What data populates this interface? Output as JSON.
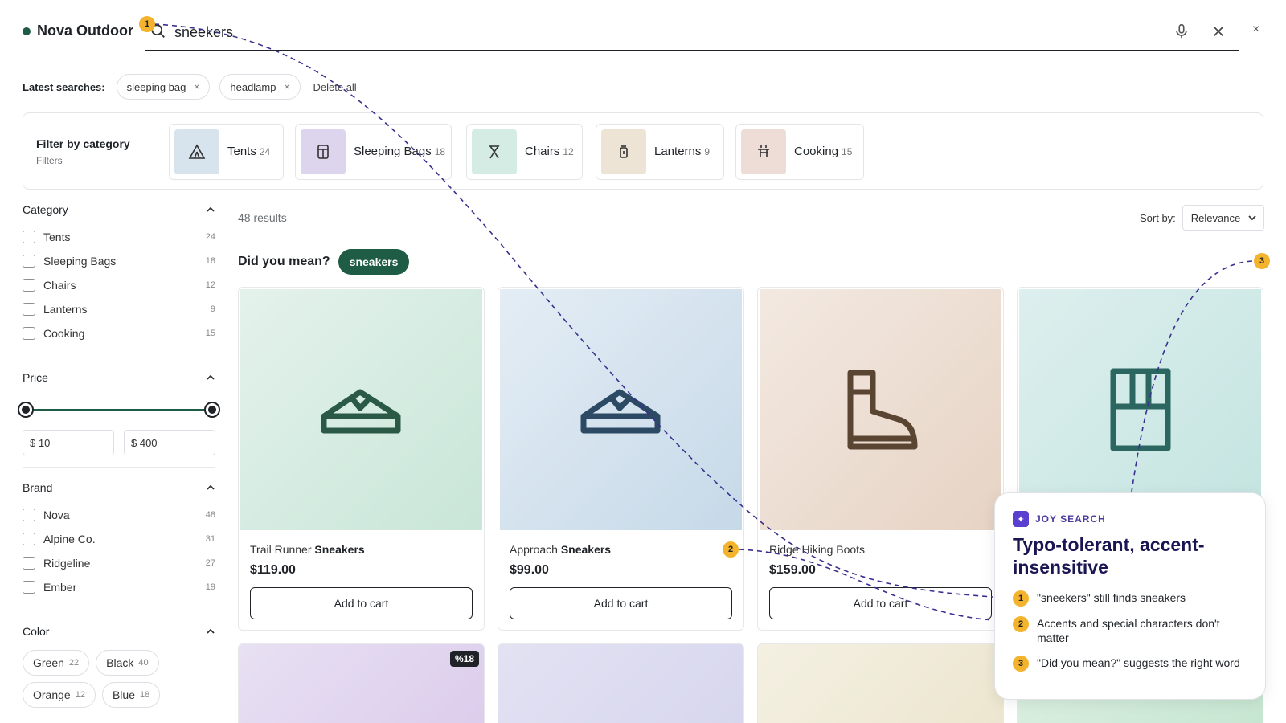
{
  "header": {
    "brand": "Nova Outdoor",
    "search_value": "sneekers",
    "close_label": "×"
  },
  "latest": {
    "label": "Latest searches:",
    "items": [
      "sleeping bag",
      "headlamp"
    ],
    "delete_all": "Delete all"
  },
  "category_bar": {
    "title": "Filter by category",
    "subtitle": "Filters",
    "items": [
      {
        "name": "Tents",
        "count": "24",
        "icon": "tent-icon",
        "bg": "#d7e4ee"
      },
      {
        "name": "Sleeping Bags",
        "count": "18",
        "icon": "sleeping-bag-icon",
        "bg": "#ddd5ee"
      },
      {
        "name": "Chairs",
        "count": "12",
        "icon": "chair-icon",
        "bg": "#d4ece3"
      },
      {
        "name": "Lanterns",
        "count": "9",
        "icon": "lantern-icon",
        "bg": "#ede4d6"
      },
      {
        "name": "Cooking",
        "count": "15",
        "icon": "grill-icon",
        "bg": "#eedcd6"
      }
    ]
  },
  "sidebar": {
    "category": {
      "title": "Category",
      "items": [
        {
          "label": "Tents",
          "count": "24"
        },
        {
          "label": "Sleeping Bags",
          "count": "18"
        },
        {
          "label": "Chairs",
          "count": "12"
        },
        {
          "label": "Lanterns",
          "count": "9"
        },
        {
          "label": "Cooking",
          "count": "15"
        }
      ]
    },
    "price": {
      "title": "Price",
      "min": "$ 10",
      "max": "$ 400"
    },
    "brand": {
      "title": "Brand",
      "items": [
        {
          "label": "Nova",
          "count": "48"
        },
        {
          "label": "Alpine Co.",
          "count": "31"
        },
        {
          "label": "Ridgeline",
          "count": "27"
        },
        {
          "label": "Ember",
          "count": "19"
        }
      ]
    },
    "color": {
      "title": "Color",
      "items": [
        {
          "label": "Green",
          "count": "22"
        },
        {
          "label": "Black",
          "count": "40"
        },
        {
          "label": "Orange",
          "count": "12"
        },
        {
          "label": "Blue",
          "count": "18"
        }
      ]
    }
  },
  "results": {
    "count": "48 results",
    "sort_label": "Sort by:",
    "sort_value": "Relevance",
    "did_you_mean_label": "Did you mean?",
    "did_you_mean_term": "sneakers"
  },
  "products": [
    {
      "prefix": "Trail Runner ",
      "bold": "Sneakers",
      "price": "$119.00",
      "cta": "Add to cart",
      "icon": "sneaker-icon"
    },
    {
      "prefix": "Approach ",
      "bold": "Sneakers",
      "price": "$99.00",
      "cta": "Add to cart",
      "icon": "sneaker-icon"
    },
    {
      "prefix": "Ridge Hiking Boots",
      "bold": "",
      "price": "$159.00",
      "cta": "Add to cart",
      "icon": "boot-icon"
    },
    {
      "prefix": "",
      "bold": "",
      "price": "",
      "cta": "",
      "icon": "backpack-icon"
    }
  ],
  "second_row": {
    "discount": "%18"
  },
  "joy": {
    "tag": "JOY SEARCH",
    "title": "Typo-tolerant, accent-insensitive",
    "points": [
      {
        "num": "1",
        "text": "\"sneekers\" still finds sneakers"
      },
      {
        "num": "2",
        "text": "Accents and special characters don't matter"
      },
      {
        "num": "3",
        "text": "\"Did you mean?\" suggests the right word"
      }
    ]
  },
  "markers": [
    "1",
    "2",
    "3"
  ],
  "colors": {
    "brand_green": "#1f5c45",
    "marker": "#f4b32c",
    "callout_title": "#1a1553"
  }
}
